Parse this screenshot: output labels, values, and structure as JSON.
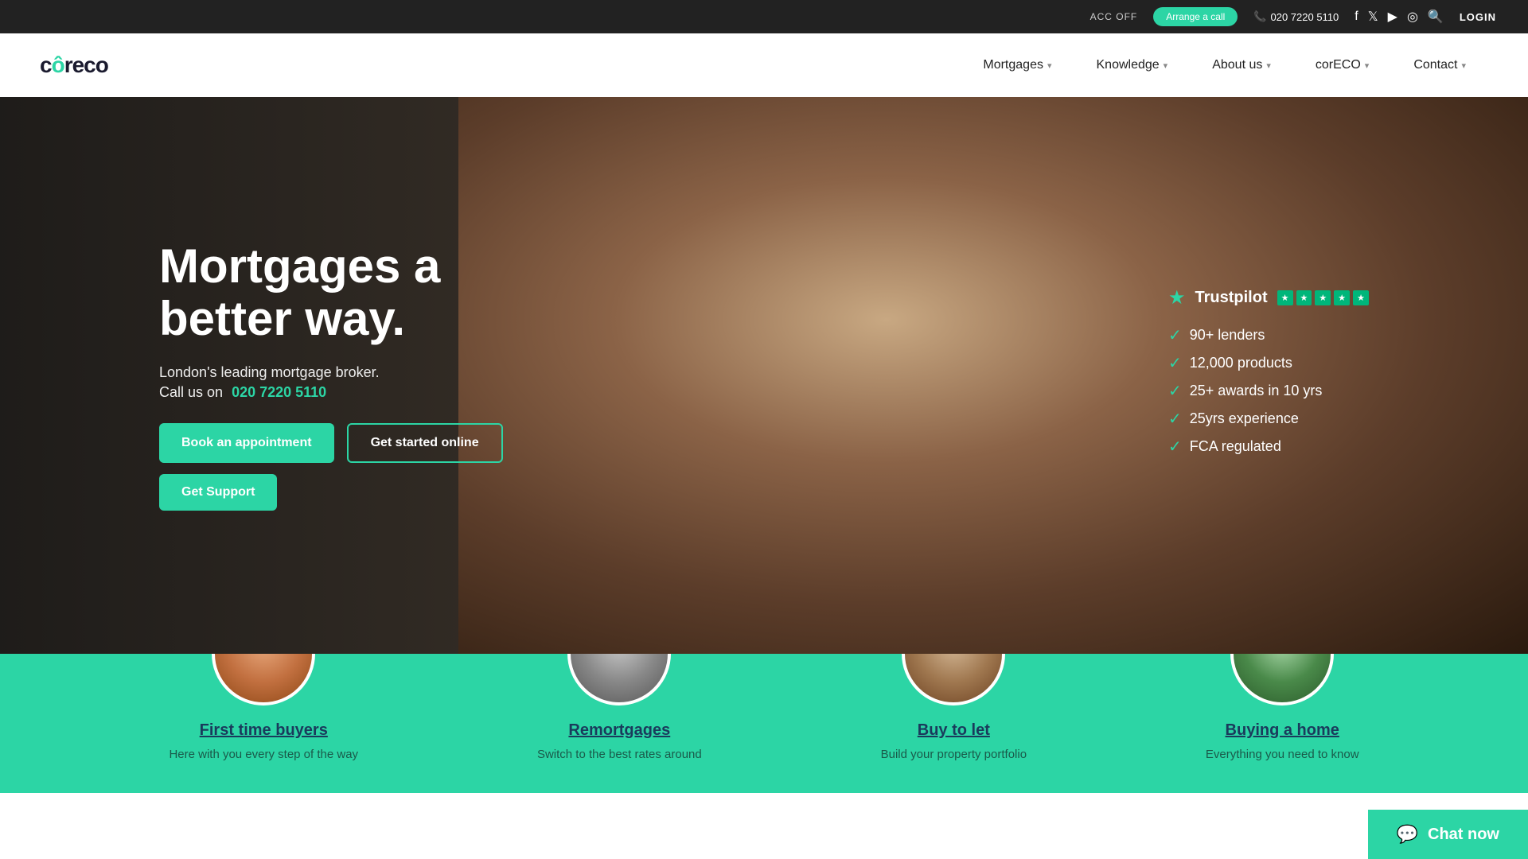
{
  "topbar": {
    "acc_off": "ACC OFF",
    "arrange_call": "Arrange a call",
    "phone": "020 7220 5110",
    "login": "LOGIN"
  },
  "nav": {
    "logo": "coreco",
    "links": [
      {
        "label": "Mortgages",
        "has_dropdown": true
      },
      {
        "label": "Knowledge",
        "has_dropdown": true
      },
      {
        "label": "About us",
        "has_dropdown": true
      },
      {
        "label": "corECO",
        "has_dropdown": true
      },
      {
        "label": "Contact",
        "has_dropdown": true
      }
    ]
  },
  "hero": {
    "title": "Mortgages a better way.",
    "subtitle": "London's leading mortgage broker.",
    "call_us": "Call us on",
    "phone": "020 7220 5110",
    "btn_appointment": "Book an appointment",
    "btn_started": "Get started online",
    "btn_support": "Get Support"
  },
  "trust": {
    "trustpilot_label": "Trustpilot",
    "items": [
      "90+ lenders",
      "12,000 products",
      "25+ awards in 10 yrs",
      "25yrs experience",
      "FCA regulated"
    ]
  },
  "categories": [
    {
      "title": "First time buyers",
      "desc": "Here with you every step of the way",
      "avatar_class": "av1"
    },
    {
      "title": "Remortgages",
      "desc": "Switch to the best rates around",
      "avatar_class": "av2"
    },
    {
      "title": "Buy to let",
      "desc": "Build your property portfolio",
      "avatar_class": "av3"
    },
    {
      "title": "Buying a home",
      "desc": "Everything you need to know",
      "avatar_class": "av4"
    }
  ],
  "chat": {
    "label": "Chat now"
  }
}
